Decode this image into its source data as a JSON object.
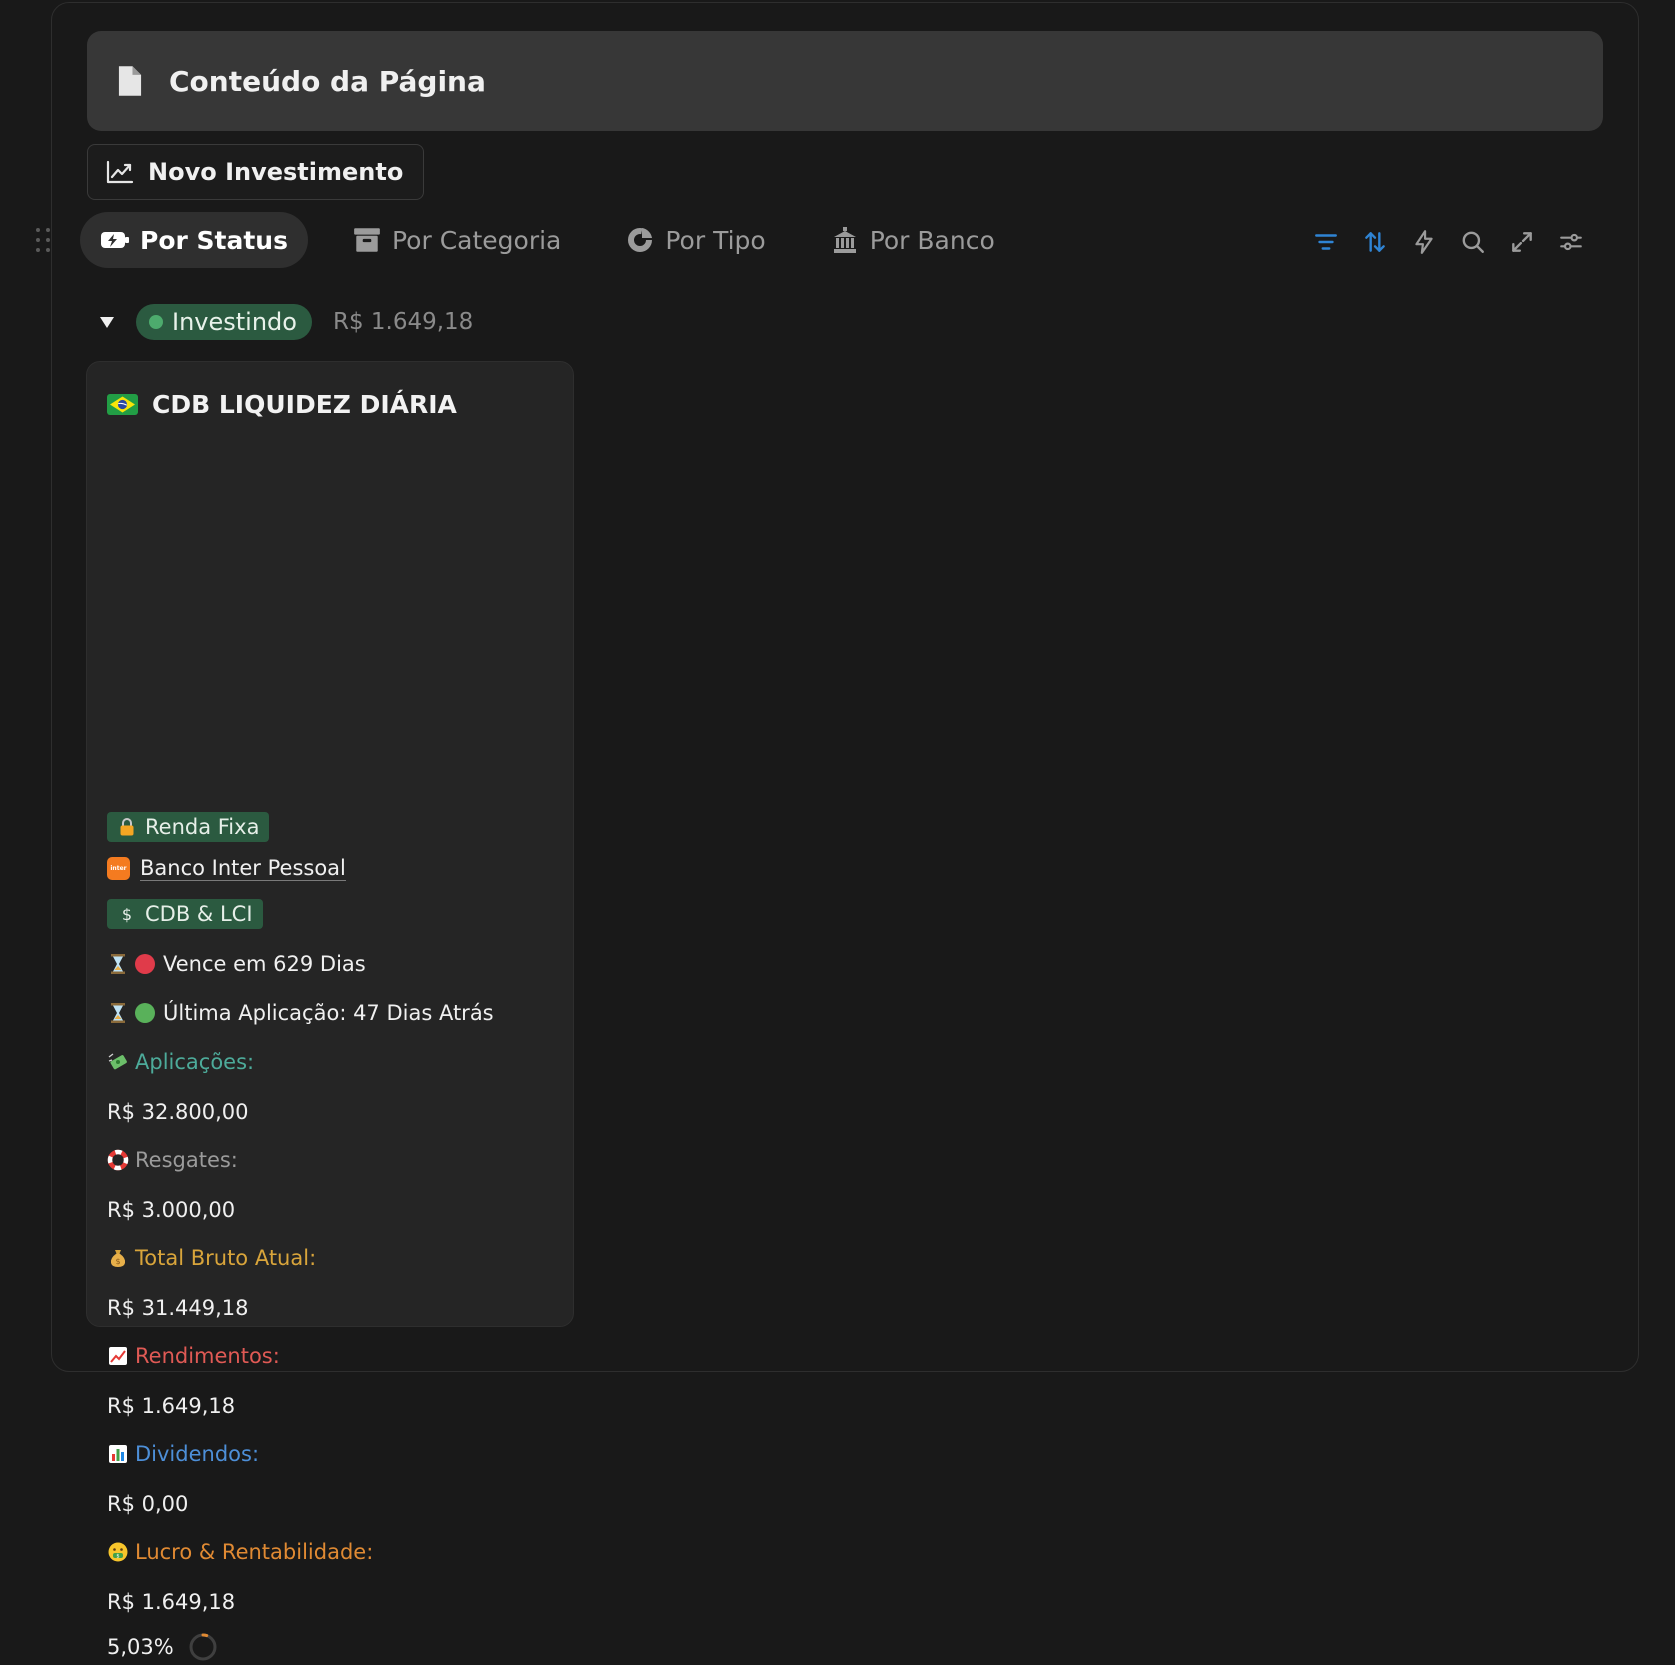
{
  "page": {
    "title": "Conteúdo da Página",
    "new_button_label": "Novo Investimento"
  },
  "tabs": [
    {
      "label": "Por Status",
      "active": true
    },
    {
      "label": "Por Categoria",
      "active": false
    },
    {
      "label": "Por Tipo",
      "active": false
    },
    {
      "label": "Por Banco",
      "active": false
    }
  ],
  "toolbar": {
    "icons": [
      "filter-icon",
      "sort-icon",
      "automation-icon",
      "search-icon",
      "expand-icon",
      "settings-icon"
    ],
    "active_color": "#2f84d4"
  },
  "group": {
    "status": "Investindo",
    "sum": "R$ 1.649,18",
    "color": "#2b5a40"
  },
  "card": {
    "title": "CDB LIQUIDEZ DIÁRIA",
    "category_tag": "Renda Fixa",
    "bank": "Banco Inter Pessoal",
    "bank_logo_text": "inter",
    "type_tag": "CDB & LCI",
    "maturity": "Vence em 629 Dias",
    "last_application": "Última Aplicação: 47 Dias Atrás",
    "applications_label": "Aplicações:",
    "applications_value": "R$ 32.800,00",
    "redemptions_label": "Resgates:",
    "redemptions_value": "R$ 3.000,00",
    "gross_total_label": "Total Bruto Atual:",
    "gross_total_value": "R$ 31.449,18",
    "earnings_label": "Rendimentos:",
    "earnings_value": "R$ 1.649,18",
    "dividends_label": "Dividendos:",
    "dividends_value": "R$ 0,00",
    "profit_label": "Lucro & Rentabilidade:",
    "profit_value": "R$ 1.649,18",
    "profitability_percent": "5,03%",
    "profitability_fraction": 0.0503
  }
}
